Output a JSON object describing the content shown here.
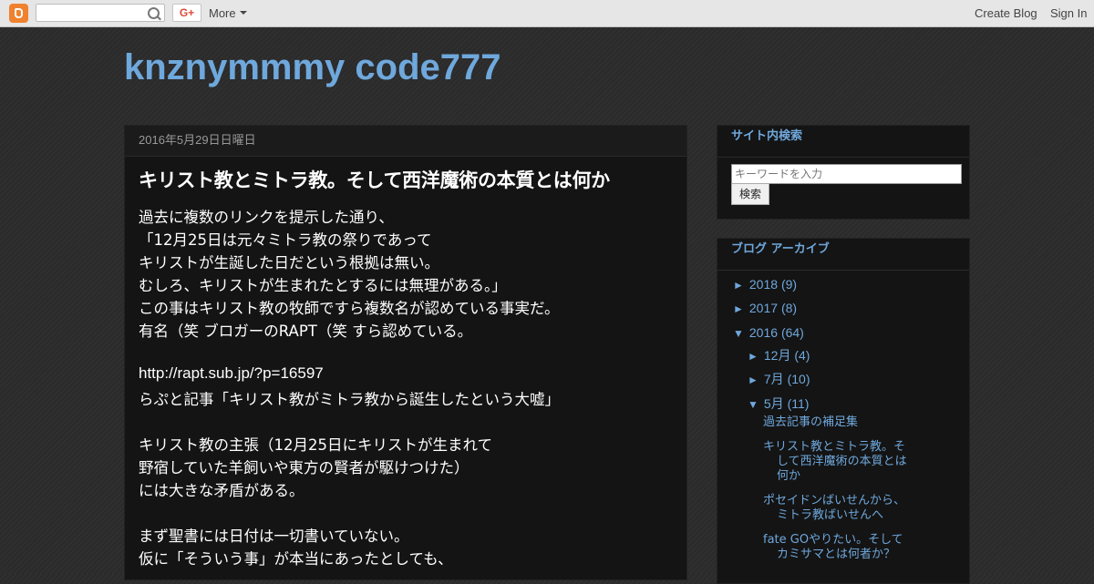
{
  "navbar": {
    "more_label": "More",
    "gplus_label": "G+",
    "create_blog_label": "Create Blog",
    "sign_in_label": "Sign In"
  },
  "blog": {
    "title": "knznymmmy code777"
  },
  "post": {
    "date": "2016年5月29日日曜日",
    "title": "キリスト教とミトラ教。そして西洋魔術の本質とは何か",
    "lines": [
      "過去に複数のリンクを提示した通り、",
      "「12月25日は元々ミトラ教の祭りであって",
      "キリストが生誕した日だという根拠は無い。",
      "むしろ、キリストが生まれたとするには無理がある。」",
      "この事はキリスト教の牧師ですら複数名が認めている事実だ。",
      "有名（笑 ブロガーのRAPT（笑 すら認めている。",
      "",
      "http://rapt.sub.jp/?p=16597",
      "らぷと記事「キリスト教がミトラ教から誕生したという大嘘」",
      "",
      "キリスト教の主張（12月25日にキリストが生まれて",
      "野宿していた羊飼いや東方の賢者が駆けつけた）",
      "には大きな矛盾がある。",
      "",
      "まず聖書には日付は一切書いていない。",
      "仮に「そういう事」が本当にあったとしても、"
    ]
  },
  "sidebar": {
    "search": {
      "title": "サイト内検索",
      "placeholder": "キーワードを入力",
      "button_label": "検索"
    },
    "archive": {
      "title": "ブログ アーカイブ",
      "years": [
        {
          "toggle": "►",
          "label": "2018",
          "count": "(9)"
        },
        {
          "toggle": "►",
          "label": "2017",
          "count": "(8)"
        },
        {
          "toggle": "▼",
          "label": "2016",
          "count": "(64)"
        }
      ],
      "months": [
        {
          "toggle": "►",
          "label": "12月",
          "count": "(4)"
        },
        {
          "toggle": "►",
          "label": "7月",
          "count": "(10)"
        },
        {
          "toggle": "▼",
          "label": "5月",
          "count": "(11)"
        }
      ],
      "posts": [
        "過去記事の補足集",
        "キリスト教とミトラ教。そして西洋魔術の本質とは何か",
        "ポセイドンばいせんから、ミトラ教ばいせんへ",
        "fate GOやりたい。そしてカミサマとは何者か？"
      ]
    }
  }
}
